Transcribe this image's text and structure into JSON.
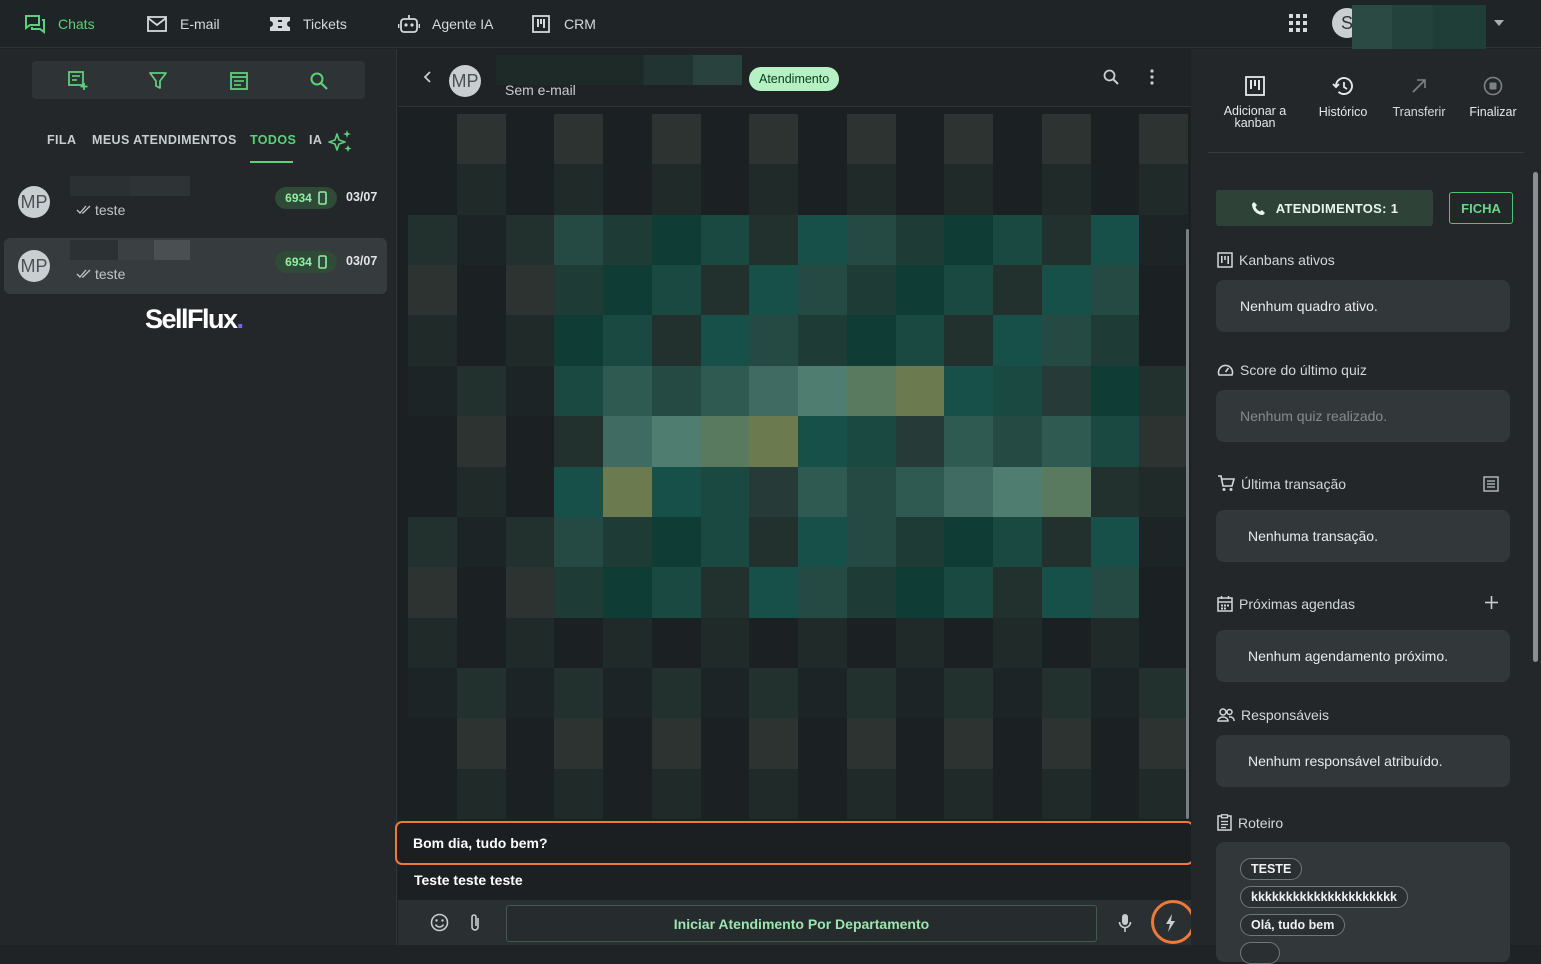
{
  "nav": {
    "items": [
      {
        "label": "Chats",
        "icon": "chats-icon"
      },
      {
        "label": "E-mail",
        "icon": "mail-icon"
      },
      {
        "label": "Tickets",
        "icon": "ticket-icon"
      },
      {
        "label": "Agente IA",
        "icon": "robot-icon"
      },
      {
        "label": "CRM",
        "icon": "kanban-icon"
      }
    ],
    "user_initial": "S",
    "accent": "#5bd17a"
  },
  "left": {
    "tabs": [
      "FILA",
      "MEUS ATENDIMENTOS",
      "TODOS",
      "IA"
    ],
    "active_tab": "TODOS",
    "chats": [
      {
        "initials": "MP",
        "last_message": "teste",
        "badge": "6934",
        "date": "03/07"
      },
      {
        "initials": "MP",
        "last_message": "teste",
        "badge": "6934",
        "date": "03/07"
      }
    ],
    "logo_main": "SellFlux",
    "logo_dot": "."
  },
  "center": {
    "contact_initials": "MP",
    "contact_email": "Sem e-mail",
    "status": "Atendimento",
    "quick_replies": [
      "Bom dia, tudo bem?",
      "Teste teste teste"
    ],
    "department_button": "Iniciar Atendimento Por Departamento"
  },
  "right": {
    "actions": [
      {
        "label": "Adicionar a kanban",
        "icon": "kanban-icon"
      },
      {
        "label": "Histórico",
        "icon": "history-icon"
      },
      {
        "label": "Transferir",
        "icon": "transfer-icon"
      },
      {
        "label": "Finalizar",
        "icon": "stop-icon"
      }
    ],
    "atendimentos_label": "ATENDIMENTOS: 1",
    "ficha_label": "FICHA",
    "sections": {
      "kanbans": {
        "title": "Kanbans ativos",
        "empty": "Nenhum quadro ativo."
      },
      "quiz": {
        "title": "Score do último quiz",
        "empty": "Nenhum quiz realizado."
      },
      "transacao": {
        "title": "Última transação",
        "empty": "Nenhuma transação."
      },
      "agendas": {
        "title": "Próximas agendas",
        "empty": "Nenhum agendamento próximo."
      },
      "responsaveis": {
        "title": "Responsáveis",
        "empty": "Nenhum responsável atribuído."
      },
      "roteiro": {
        "title": "Roteiro",
        "chips": [
          "TESTE",
          "kkkkkkkkkkkkkkkkkkkkk",
          "Olá, tudo bem"
        ]
      }
    }
  },
  "colors": {
    "orange_highlight": "#f07838",
    "status_pill": "#b6f1c4"
  }
}
